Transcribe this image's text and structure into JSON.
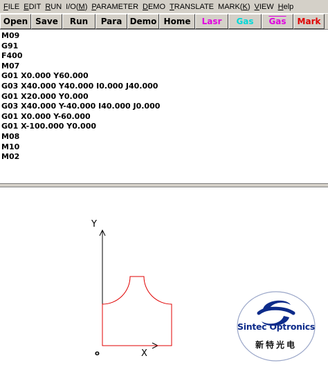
{
  "menu": {
    "items": [
      {
        "mn": "F",
        "rest": "ILE"
      },
      {
        "mn": "E",
        "rest": "DIT"
      },
      {
        "mn": "R",
        "rest": "UN"
      },
      {
        "mn": "",
        "rest": "I/O(",
        "mn2": "M",
        "rest2": ")"
      },
      {
        "mn": "P",
        "rest": "ARAMETER"
      },
      {
        "mn": "D",
        "rest": "EMO"
      },
      {
        "mn": "T",
        "rest": "RANSLATE"
      },
      {
        "mn": "",
        "rest": "MARK(",
        "mn2": "K",
        "rest2": ")"
      },
      {
        "mn": "V",
        "rest": "IEW"
      },
      {
        "mn": "H",
        "rest": "elp"
      }
    ]
  },
  "toolbar": {
    "open": "Open",
    "save": "Save",
    "run": "Run",
    "para": "Para",
    "demo": "Demo",
    "home": "Home",
    "lasr": "Lasr",
    "gas1": "Gas",
    "gas2": "Gas",
    "mark": "Mark",
    "colors": {
      "lasr": "#e000e0",
      "gas1": "#00d8d8",
      "gas2": "#e000e0",
      "mark": "#e00000"
    }
  },
  "editor": {
    "lines": [
      "M09",
      "G91",
      "F400",
      "M07",
      "G01 X0.000 Y60.000",
      "G03 X40.000 Y40.000 I0.000 J40.000",
      "G01 X20.000 Y0.000",
      "G03 X40.000 Y-40.000 I40.000 J0.000",
      "G01 X0.000 Y-60.000",
      "G01 X-100.000 Y0.000",
      "M08",
      "M10",
      "M02"
    ]
  },
  "plot": {
    "y_label": "Y",
    "x_label": "X",
    "origin_label": "o",
    "path_color": "#e00000",
    "axis_color": "#000000"
  },
  "logo": {
    "text": "Sintec Optronics",
    "subtext": "新特光电",
    "icon": "sintec-swirl-logo",
    "color": "#0d2b8a"
  }
}
